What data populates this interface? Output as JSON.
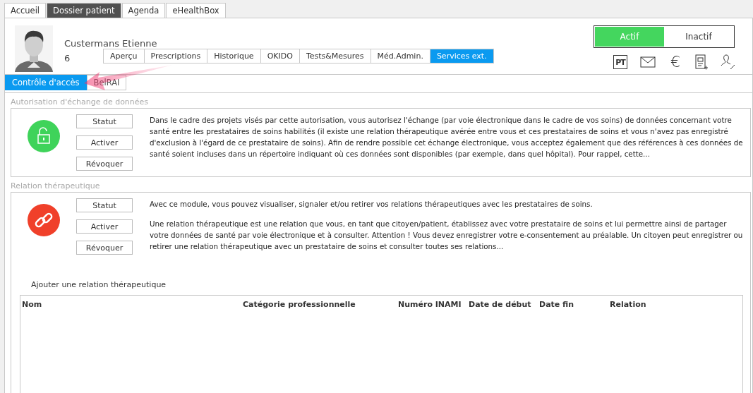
{
  "main_tabs": [
    {
      "label": "Accueil",
      "selected": false
    },
    {
      "label": "Dossier patient",
      "selected": true
    },
    {
      "label": "Agenda",
      "selected": false
    },
    {
      "label": "eHealthBox",
      "selected": false
    }
  ],
  "patient": {
    "name": "Custermans Etienne",
    "number": "6"
  },
  "status_toggle": [
    {
      "label": "Actif",
      "selected": true
    },
    {
      "label": "Inactif",
      "selected": false
    }
  ],
  "record_tabs": [
    {
      "label": "Aperçu",
      "selected": false
    },
    {
      "label": "Prescriptions",
      "selected": false
    },
    {
      "label": "Historique",
      "selected": false
    },
    {
      "label": "OKIDO",
      "selected": false
    },
    {
      "label": "Tests&Mesures",
      "selected": false
    },
    {
      "label": "Méd.Admin.",
      "selected": false
    },
    {
      "label": "Services ext.",
      "selected": true
    }
  ],
  "toolbar_icons": [
    {
      "kind": "pt",
      "text": "PT"
    },
    {
      "kind": "mail"
    },
    {
      "kind": "euro",
      "text": "€"
    },
    {
      "kind": "document"
    },
    {
      "kind": "user"
    }
  ],
  "sub_tabs": [
    {
      "label": "Contrôle d'accès",
      "selected": true
    },
    {
      "label": "BelRAI",
      "selected": false
    }
  ],
  "sections": [
    {
      "title": "Autorisation d'échange de données",
      "kind": "unlock",
      "color": "#3fd35a",
      "buttons": [
        "Statut",
        "Activer",
        "Révoquer"
      ],
      "paragraphs": [
        "Dans le cadre des projets visés par cette autorisation, vous autorisez l'échange (par voie électronique dans le cadre de vos soins) de données concernant votre santé entre les prestataires de soins habilités (il existe une relation thérapeutique avérée entre vous et ces prestataires de soins et vous n'avez pas enregistré d'exclusion à l'égard de ce prestataire de soins). Afin de rendre possible cet échange électronique, vous acceptez également que des références à ces données de santé soient incluses dans un répertoire indiquant où ces données sont disponibles (par exemple, dans quel hôpital). Pour rappel, cette..."
      ]
    },
    {
      "title": "Relation thérapeutique",
      "kind": "broken-link",
      "color": "#f0402a",
      "buttons": [
        "Statut",
        "Activer",
        "Révoquer"
      ],
      "paragraphs": [
        "Avec ce module, vous pouvez visualiser, signaler et/ou retirer vos relations thérapeutiques avec les prestataires de soins.",
        "Une relation thérapeutique est une relation que vous, en tant que citoyen/patient, établissez avec votre prestataire de soins et lui permettre ainsi de partager votre données de santé par voie électronique et à consulter. Attention ! Vous devez enregistrer votre e-consentement au préalable. Un citoyen peut enregistrer ou retirer une relation thérapeutique avec un prestataire de soins et consulter toutes ses relations..."
      ],
      "table": {
        "caption": "Ajouter une relation thérapeutique",
        "columns": [
          "Nom",
          "Catégorie professionnelle",
          "Numéro INAMI",
          "Date de début",
          "Date fin",
          "Relation"
        ]
      }
    }
  ]
}
